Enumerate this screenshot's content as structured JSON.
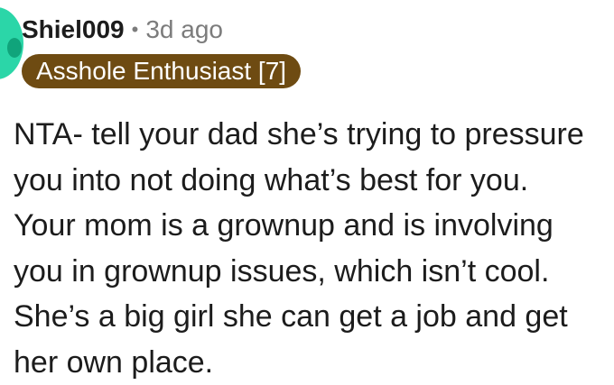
{
  "comment": {
    "author": "Shiel009",
    "separator": "•",
    "timestamp": "3d ago",
    "flair": "Asshole Enthusiast [7]",
    "avatar_icon": "snoo-avatar-icon",
    "body_lines": [
      "NTA- tell your dad she’s trying to pressure",
      "you into not doing what’s best for you.",
      "Your mom is a grownup and is involving",
      "you in grownup issues, which isn’t cool.",
      "She’s a big girl she can get a job and get",
      "her own place."
    ]
  },
  "colors": {
    "avatar": "#2bd6a8",
    "flair_background": "#6e4b12",
    "flair_text": "#ffffff",
    "meta_text": "#7c7c7c",
    "body_text": "#1c1c1c"
  }
}
